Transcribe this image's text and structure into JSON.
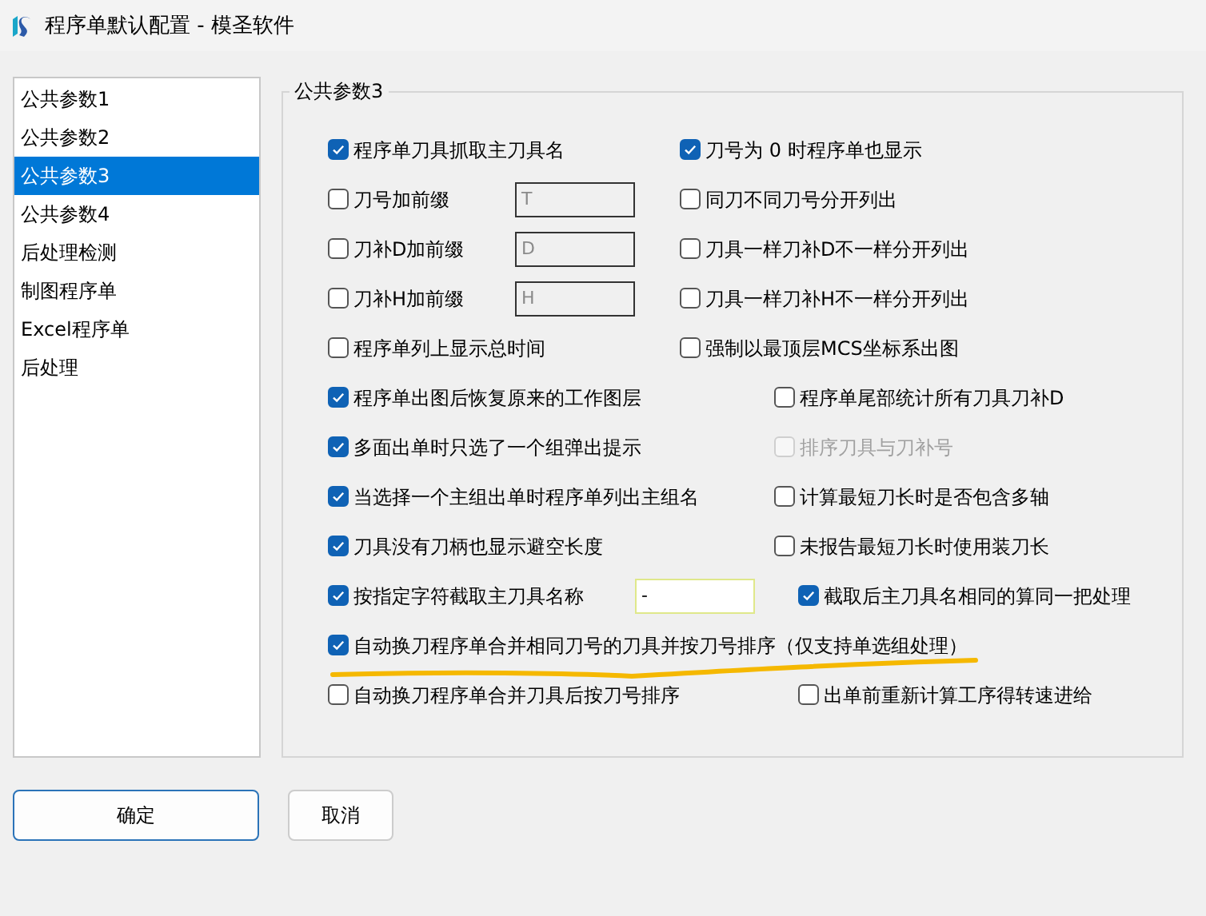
{
  "window": {
    "title": "程序单默认配置 - 模圣软件"
  },
  "sidebar": {
    "items": [
      {
        "label": "公共参数1",
        "selected": false
      },
      {
        "label": "公共参数2",
        "selected": false
      },
      {
        "label": "公共参数3",
        "selected": true
      },
      {
        "label": "公共参数4",
        "selected": false
      },
      {
        "label": "后处理检测",
        "selected": false
      },
      {
        "label": "制图程序单",
        "selected": false
      },
      {
        "label": "Excel程序单",
        "selected": false
      },
      {
        "label": "后处理",
        "selected": false
      }
    ]
  },
  "group": {
    "title": "公共参数3",
    "rows": [
      {
        "kind": "narrow",
        "left": [
          {
            "kind": "checkbox",
            "label": "程序单刀具抓取主刀具名",
            "checked": true,
            "disabled": false
          }
        ],
        "right": [
          {
            "kind": "checkbox",
            "label": "刀号为 0 时程序单也显示",
            "checked": true,
            "disabled": false
          }
        ]
      },
      {
        "kind": "narrow",
        "left": [
          {
            "kind": "checkbox",
            "label": "刀号加前缀",
            "checked": false,
            "disabled": false
          },
          {
            "kind": "field",
            "value": "T",
            "disabled": true
          }
        ],
        "right": [
          {
            "kind": "checkbox",
            "label": "同刀不同刀号分开列出",
            "checked": false,
            "disabled": false
          }
        ]
      },
      {
        "kind": "narrow",
        "left": [
          {
            "kind": "checkbox",
            "label": "刀补D加前缀",
            "checked": false,
            "disabled": false
          },
          {
            "kind": "field",
            "value": "D",
            "disabled": true
          }
        ],
        "right": [
          {
            "kind": "checkbox",
            "label": "刀具一样刀补D不一样分开列出",
            "checked": false,
            "disabled": false
          }
        ]
      },
      {
        "kind": "narrow",
        "left": [
          {
            "kind": "checkbox",
            "label": "刀补H加前缀",
            "checked": false,
            "disabled": false
          },
          {
            "kind": "field",
            "value": "H",
            "disabled": true
          }
        ],
        "right": [
          {
            "kind": "checkbox",
            "label": "刀具一样刀补H不一样分开列出",
            "checked": false,
            "disabled": false
          }
        ]
      },
      {
        "kind": "narrow",
        "left": [
          {
            "kind": "checkbox",
            "label": "程序单列上显示总时间",
            "checked": false,
            "disabled": false
          }
        ],
        "right": [
          {
            "kind": "checkbox",
            "label": "强制以最顶层MCS坐标系出图",
            "checked": false,
            "disabled": false
          }
        ]
      },
      {
        "kind": "wide",
        "left": [
          {
            "kind": "checkbox",
            "label": "程序单出图后恢复原来的工作图层",
            "checked": true,
            "disabled": false
          }
        ],
        "right": [
          {
            "kind": "checkbox",
            "label": "程序单尾部统计所有刀具刀补D",
            "checked": false,
            "disabled": false
          }
        ]
      },
      {
        "kind": "wide",
        "left": [
          {
            "kind": "checkbox",
            "label": "多面出单时只选了一个组弹出提示",
            "checked": true,
            "disabled": false
          }
        ],
        "right": [
          {
            "kind": "checkbox",
            "label": "排序刀具与刀补号",
            "checked": false,
            "disabled": true
          }
        ]
      },
      {
        "kind": "wide",
        "left": [
          {
            "kind": "checkbox",
            "label": "当选择一个主组出单时程序单列出主组名",
            "checked": true,
            "disabled": false
          }
        ],
        "right": [
          {
            "kind": "checkbox",
            "label": "计算最短刀长时是否包含多轴",
            "checked": false,
            "disabled": false
          }
        ]
      },
      {
        "kind": "wide",
        "left": [
          {
            "kind": "checkbox",
            "label": "刀具没有刀柄也显示避空长度",
            "checked": true,
            "disabled": false
          }
        ],
        "right": [
          {
            "kind": "checkbox",
            "label": "未报告最短刀长时使用装刀长",
            "checked": false,
            "disabled": false
          }
        ]
      },
      {
        "kind": "tool",
        "left": [
          {
            "kind": "checkbox",
            "label": "按指定字符截取主刀具名称",
            "checked": true,
            "disabled": false
          },
          {
            "kind": "field",
            "value": "-",
            "disabled": false
          }
        ],
        "right": [
          {
            "kind": "checkbox",
            "label": "截取后主刀具名相同的算同一把处理",
            "checked": true,
            "disabled": false
          }
        ]
      },
      {
        "kind": "full",
        "left": [
          {
            "kind": "checkbox",
            "label": "自动换刀程序单合并相同刀号的刀具并按刀号排序（仅支持单选组处理）",
            "checked": true,
            "disabled": false
          }
        ]
      },
      {
        "kind": "tool",
        "left": [
          {
            "kind": "checkbox",
            "label": "自动换刀程序单合并刀具后按刀号排序",
            "checked": false,
            "disabled": false
          }
        ],
        "right": [
          {
            "kind": "checkbox",
            "label": "出单前重新计算工序得转速进给",
            "checked": false,
            "disabled": false
          }
        ]
      }
    ]
  },
  "buttons": [
    {
      "label": "确定",
      "kind": "default"
    },
    {
      "label": "取消",
      "kind": "normal"
    }
  ]
}
